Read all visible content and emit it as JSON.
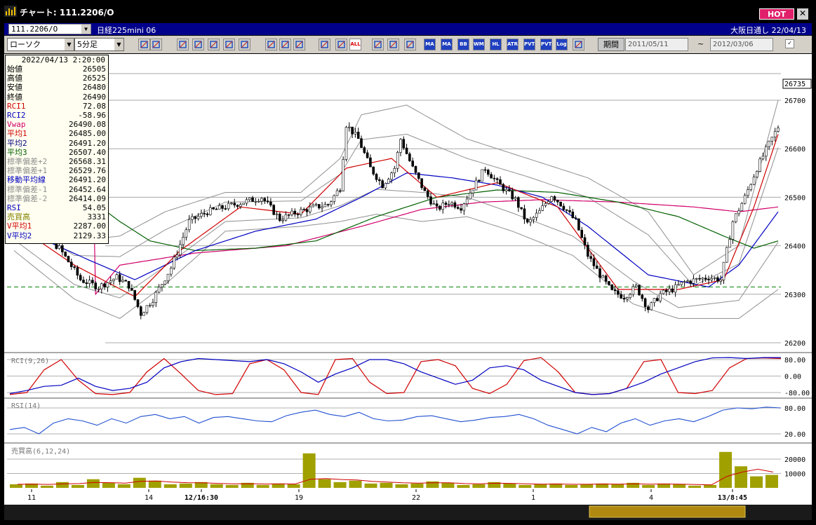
{
  "window": {
    "title": "チャート: 111.2206/O",
    "hot_label": "HOT",
    "close_label": "✕"
  },
  "symbol_bar": {
    "symbol": "111.2206/O",
    "name": "日経225mini 06",
    "right_text": "大阪日通し  22/04/13"
  },
  "toolbar": {
    "chart_type": "ローソク",
    "interval": "5分足",
    "buttons": [
      "zoom-icon",
      "cursor-icon",
      "search-icon",
      "search-icon",
      "compare-icon",
      "compare-icon",
      "info-icon",
      "draw-line-icon",
      "arrow-icon",
      "undo-icon",
      "candle-icon",
      "candle-icon",
      "ALL",
      "settings-icon",
      "brush-icon",
      "color-icon",
      "MA",
      "MA",
      "BB",
      "WMA",
      "HL",
      "ATR",
      "PVT",
      "PVT",
      "Log",
      "export-icon"
    ],
    "button_labels": {
      "ma1": "MA",
      "ma2": "MA",
      "bb": "BB",
      "wma": "WMA",
      "hl": "HL",
      "atr": "ATR",
      "pvt1": "PVT",
      "pvt2": "PVT",
      "log": "Log",
      "all": "ALL"
    },
    "period_label": "期間",
    "date_from": "2011/05/11",
    "tilde": "~",
    "date_to": "2012/03/06"
  },
  "info": {
    "date": "2022/04/13 2:20:00",
    "rows": [
      {
        "label": "始値",
        "value": "26505",
        "color": "#000000"
      },
      {
        "label": "高値",
        "value": "26525",
        "color": "#000000"
      },
      {
        "label": "安値",
        "value": "26480",
        "color": "#000000"
      },
      {
        "label": "終値",
        "value": "26490",
        "color": "#000000"
      },
      {
        "label": "RCI1",
        "value": "72.08",
        "color": "#d00000"
      },
      {
        "label": "RCI2",
        "value": "-58.96",
        "color": "#0000c0"
      },
      {
        "label": "Vwap",
        "value": "26490.08",
        "color": "#d0006a"
      },
      {
        "label": "平均1",
        "value": "26485.00",
        "color": "#d00000"
      },
      {
        "label": "平均2",
        "value": "26491.20",
        "color": "#000080"
      },
      {
        "label": "平均3",
        "value": "26507.40",
        "color": "#006000"
      },
      {
        "label": "標準偏差+2",
        "value": "26568.31",
        "color": "#909090"
      },
      {
        "label": "標準偏差+1",
        "value": "26529.76",
        "color": "#909090"
      },
      {
        "label": "移動平均線",
        "value": "26491.20",
        "color": "#0000c0"
      },
      {
        "label": "標準偏差-1",
        "value": "26452.64",
        "color": "#909090"
      },
      {
        "label": "標準偏差-2",
        "value": "26414.09",
        "color": "#909090"
      },
      {
        "label": "RSI",
        "value": "54.05",
        "color": "#0000c0"
      },
      {
        "label": "売買高",
        "value": "3331",
        "color": "#808000"
      },
      {
        "label": "V平均1",
        "value": "2287.00",
        "color": "#d00000"
      },
      {
        "label": "V平均2",
        "value": "2129.33",
        "color": "#0000c0"
      }
    ]
  },
  "colors": {
    "up_candle": "#ffffff",
    "down_candle": "#000000",
    "ma1": "#d00000",
    "ma2": "#0000c0",
    "ma3": "#006000",
    "vwap": "#d0006a",
    "band": "#909090",
    "rsi": "#2050d0",
    "volume": "#a0a000",
    "dashed_level": "#008000"
  },
  "chart_data": [
    {
      "type": "candlestick",
      "title": "",
      "ylim": [
        26200,
        26735
      ],
      "y_ticks": [
        26200,
        26300,
        26400,
        26500,
        26600,
        26700
      ],
      "y_tick_labels": [
        "26200",
        "26300",
        "26400",
        "26500",
        "26600",
        "26700"
      ],
      "last_price_label": "26735",
      "dashed_level": 26315,
      "x_tick_labels": [
        "11",
        "14",
        "12/16:30",
        "19",
        "22",
        "1",
        "4",
        "13/8:45"
      ],
      "price_path": [
        [
          0,
          26460
        ],
        [
          8,
          26430
        ],
        [
          15,
          26395
        ],
        [
          22,
          26330
        ],
        [
          28,
          26315
        ],
        [
          34,
          26335
        ],
        [
          38,
          26318
        ],
        [
          42,
          26260
        ],
        [
          46,
          26290
        ],
        [
          52,
          26355
        ],
        [
          58,
          26450
        ],
        [
          64,
          26470
        ],
        [
          70,
          26480
        ],
        [
          76,
          26490
        ],
        [
          82,
          26500
        ],
        [
          88,
          26455
        ],
        [
          94,
          26470
        ],
        [
          100,
          26480
        ],
        [
          104,
          26485
        ],
        [
          108,
          26520
        ],
        [
          110,
          26650
        ],
        [
          114,
          26620
        ],
        [
          118,
          26560
        ],
        [
          122,
          26525
        ],
        [
          126,
          26560
        ],
        [
          128,
          26620
        ],
        [
          132,
          26560
        ],
        [
          136,
          26510
        ],
        [
          140,
          26475
        ],
        [
          144,
          26490
        ],
        [
          148,
          26480
        ],
        [
          152,
          26520
        ],
        [
          156,
          26560
        ],
        [
          160,
          26530
        ],
        [
          166,
          26495
        ],
        [
          170,
          26445
        ],
        [
          174,
          26470
        ],
        [
          178,
          26505
        ],
        [
          182,
          26480
        ],
        [
          186,
          26450
        ],
        [
          190,
          26380
        ],
        [
          194,
          26340
        ],
        [
          198,
          26305
        ],
        [
          202,
          26295
        ],
        [
          206,
          26315
        ],
        [
          210,
          26270
        ],
        [
          214,
          26300
        ],
        [
          218,
          26310
        ],
        [
          222,
          26325
        ],
        [
          226,
          26330
        ],
        [
          230,
          26335
        ],
        [
          234,
          26330
        ],
        [
          238,
          26450
        ],
        [
          242,
          26500
        ],
        [
          246,
          26560
        ],
        [
          250,
          26610
        ],
        [
          253,
          26645
        ]
      ],
      "ma1_path": [
        [
          0,
          26445
        ],
        [
          20,
          26360
        ],
        [
          40,
          26295
        ],
        [
          55,
          26390
        ],
        [
          75,
          26480
        ],
        [
          95,
          26465
        ],
        [
          110,
          26560
        ],
        [
          125,
          26580
        ],
        [
          140,
          26500
        ],
        [
          160,
          26530
        ],
        [
          180,
          26480
        ],
        [
          200,
          26310
        ],
        [
          220,
          26310
        ],
        [
          235,
          26330
        ],
        [
          245,
          26480
        ],
        [
          253,
          26630
        ]
      ],
      "ma2_path": [
        [
          0,
          26440
        ],
        [
          25,
          26370
        ],
        [
          40,
          26330
        ],
        [
          60,
          26390
        ],
        [
          80,
          26430
        ],
        [
          100,
          26455
        ],
        [
          115,
          26500
        ],
        [
          130,
          26550
        ],
        [
          145,
          26540
        ],
        [
          160,
          26525
        ],
        [
          175,
          26500
        ],
        [
          190,
          26440
        ],
        [
          210,
          26340
        ],
        [
          230,
          26315
        ],
        [
          240,
          26360
        ],
        [
          253,
          26470
        ]
      ],
      "ma3_path": [
        [
          0,
          26590
        ],
        [
          20,
          26520
        ],
        [
          35,
          26450
        ],
        [
          45,
          26410
        ],
        [
          60,
          26390
        ],
        [
          80,
          26395
        ],
        [
          100,
          26410
        ],
        [
          120,
          26460
        ],
        [
          140,
          26500
        ],
        [
          160,
          26515
        ],
        [
          180,
          26510
        ],
        [
          200,
          26490
        ],
        [
          220,
          26460
        ],
        [
          235,
          26420
        ],
        [
          245,
          26395
        ],
        [
          253,
          26410
        ]
      ],
      "vwap_path": [
        [
          0,
          26680
        ],
        [
          10,
          26665
        ],
        [
          20,
          26630
        ],
        [
          26,
          26610
        ],
        [
          27,
          26300
        ],
        [
          35,
          26360
        ],
        [
          60,
          26385
        ],
        [
          90,
          26400
        ],
        [
          115,
          26440
        ],
        [
          135,
          26475
        ],
        [
          155,
          26490
        ],
        [
          175,
          26495
        ],
        [
          200,
          26490
        ],
        [
          225,
          26480
        ],
        [
          240,
          26470
        ],
        [
          253,
          26480
        ]
      ],
      "band_upper_path": [
        [
          0,
          26480
        ],
        [
          20,
          26410
        ],
        [
          35,
          26420
        ],
        [
          50,
          26470
        ],
        [
          70,
          26510
        ],
        [
          95,
          26510
        ],
        [
          108,
          26580
        ],
        [
          115,
          26670
        ],
        [
          130,
          26690
        ],
        [
          150,
          26620
        ],
        [
          170,
          26580
        ],
        [
          190,
          26540
        ],
        [
          210,
          26470
        ],
        [
          225,
          26340
        ],
        [
          240,
          26400
        ],
        [
          253,
          26700
        ]
      ],
      "band_lower_path": [
        [
          0,
          26390
        ],
        [
          20,
          26290
        ],
        [
          35,
          26250
        ],
        [
          50,
          26320
        ],
        [
          70,
          26430
        ],
        [
          95,
          26440
        ],
        [
          108,
          26450
        ],
        [
          120,
          26465
        ],
        [
          135,
          26450
        ],
        [
          150,
          26460
        ],
        [
          165,
          26430
        ],
        [
          185,
          26380
        ],
        [
          205,
          26280
        ],
        [
          220,
          26250
        ],
        [
          240,
          26250
        ],
        [
          253,
          26310
        ]
      ]
    },
    {
      "type": "line",
      "title": "RCI(9,26)",
      "ylim": [
        -100,
        100
      ],
      "y_tick_labels": [
        "80.00",
        "0.00",
        "-80.00"
      ],
      "y_ticks": [
        80,
        0,
        -80
      ],
      "series": [
        {
          "name": "RCI1",
          "values": [
            -90,
            -80,
            30,
            80,
            -20,
            -85,
            -90,
            -80,
            20,
            85,
            10,
            -70,
            -90,
            -85,
            60,
            80,
            30,
            -80,
            -90,
            80,
            85,
            -30,
            -85,
            -80,
            70,
            80,
            50,
            -60,
            -85,
            -40,
            75,
            90,
            20,
            -80,
            -90,
            -85,
            -60,
            70,
            80,
            -80,
            -85,
            -70,
            40,
            85,
            88,
            85
          ]
        },
        {
          "name": "RCI2",
          "values": [
            -85,
            -70,
            -50,
            -45,
            -10,
            -50,
            -70,
            -60,
            -30,
            40,
            70,
            85,
            80,
            75,
            70,
            80,
            60,
            20,
            -30,
            10,
            40,
            80,
            80,
            60,
            20,
            -10,
            -40,
            -20,
            40,
            50,
            30,
            -20,
            -50,
            -80,
            -90,
            -85,
            -60,
            -30,
            10,
            40,
            70,
            88,
            90,
            85,
            90,
            90
          ]
        }
      ]
    },
    {
      "type": "line",
      "title": "RSI(14)",
      "ylim": [
        0,
        100
      ],
      "y_tick_labels": [
        "80.00",
        "20.00"
      ],
      "y_ticks": [
        80,
        20
      ],
      "series": [
        {
          "name": "RSI",
          "values": [
            30,
            35,
            20,
            45,
            55,
            50,
            40,
            55,
            45,
            60,
            65,
            55,
            60,
            45,
            58,
            60,
            55,
            50,
            48,
            62,
            70,
            75,
            65,
            60,
            70,
            55,
            50,
            52,
            60,
            62,
            55,
            48,
            52,
            58,
            60,
            65,
            55,
            40,
            30,
            20,
            35,
            25,
            45,
            55,
            40,
            50,
            55,
            48,
            60,
            75,
            80,
            78,
            82,
            80
          ]
        }
      ]
    },
    {
      "type": "bar",
      "title": "売買高(6,12,24)",
      "ylim": [
        0,
        26000
      ],
      "y_tick_labels": [
        "20000",
        "10000"
      ],
      "y_ticks": [
        20000,
        10000
      ],
      "series": [
        {
          "name": "売買高",
          "values": [
            2500,
            3000,
            1500,
            4000,
            2000,
            6000,
            3500,
            2500,
            7000,
            5000,
            2500,
            3000,
            4000,
            2500,
            2000,
            3500,
            2000,
            3000,
            2500,
            24000,
            6000,
            4000,
            5000,
            3000,
            3500,
            2500,
            3000,
            4500,
            3500,
            2000,
            2500,
            4000,
            3000,
            2000,
            2500,
            3000,
            2000,
            2500,
            3000,
            2500,
            3500,
            2000,
            3000,
            2500,
            1500,
            2000,
            25000,
            15000,
            8000,
            9000
          ]
        },
        {
          "name": "V平均1",
          "values": [
            2500,
            2600,
            2400,
            2800,
            3000,
            3800,
            3600,
            3300,
            4600,
            4800,
            4000,
            3600,
            3500,
            3100,
            2800,
            2900,
            2700,
            2800,
            2700,
            6000,
            6500,
            5800,
            5500,
            4500,
            4000,
            3500,
            3300,
            3500,
            3500,
            3000,
            2800,
            3200,
            3100,
            2800,
            2600,
            2700,
            2500,
            2500,
            2700,
            2600,
            2800,
            2600,
            2700,
            2600,
            2300,
            2100,
            8000,
            11000,
            13000,
            11000
          ]
        }
      ]
    }
  ]
}
